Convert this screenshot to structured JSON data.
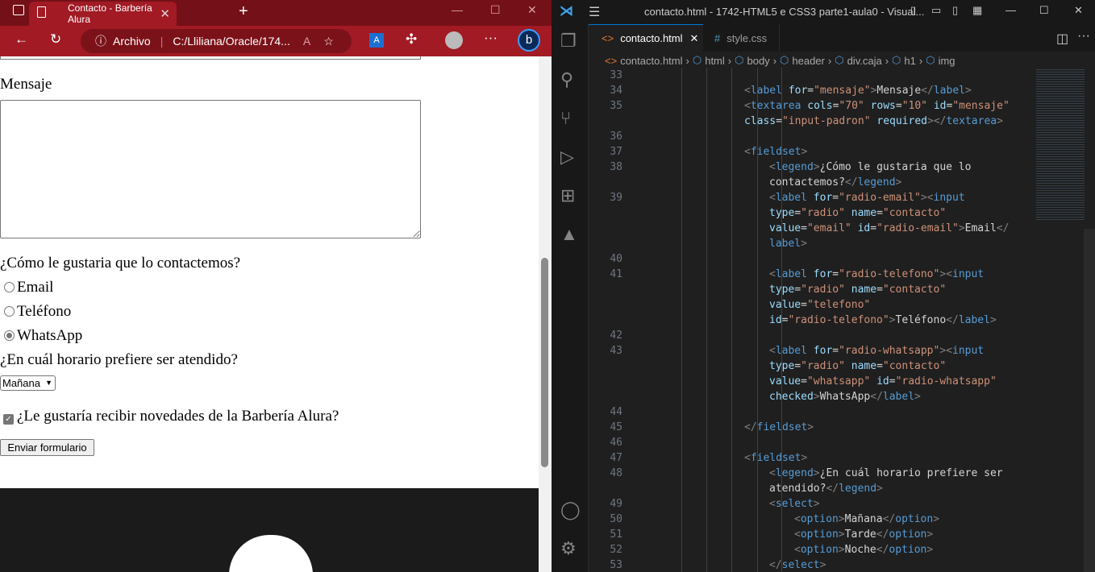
{
  "browser": {
    "tab_title": "Contacto - Barbería Alura",
    "address_scheme": "Archivo",
    "address_url": "C:/Lliliana/Oracle/174...",
    "form": {
      "message_label": "Mensaje",
      "contact_legend": "¿Cómo le gustaria que lo contactemos?",
      "radios": [
        {
          "label": "Email",
          "checked": false
        },
        {
          "label": "Teléfono",
          "checked": false
        },
        {
          "label": "WhatsApp",
          "checked": true
        }
      ],
      "schedule_legend": "¿En cuál horario prefiere ser atendido?",
      "schedule_value": "Mañana",
      "newsletter_label": "¿Le gustaría recibir novedades de la Barbería Alura?",
      "newsletter_checked": true,
      "submit_label": "Enviar formulario"
    }
  },
  "vscode": {
    "window_title": "contacto.html - 1742-HTML5 e CSS3 parte1-aula0 - Visual...",
    "tabs": [
      {
        "label": "contacto.html",
        "active": true
      },
      {
        "label": "style.css",
        "active": false
      }
    ],
    "breadcrumbs": [
      "contacto.html",
      "html",
      "body",
      "header",
      "div.caja",
      "h1",
      "img"
    ],
    "lines": [
      {
        "n": "33",
        "i": 0,
        "tk": []
      },
      {
        "n": "34",
        "i": 0,
        "tk": [
          [
            "p",
            "<"
          ],
          [
            "tg",
            "label"
          ],
          [
            "x",
            " "
          ],
          [
            "a",
            "for"
          ],
          [
            "x",
            "="
          ],
          [
            "s",
            "\"mensaje\""
          ],
          [
            "p",
            ">"
          ],
          [
            "x",
            "Mensaje"
          ],
          [
            "p",
            "</"
          ],
          [
            "tg",
            "label"
          ],
          [
            "p",
            ">"
          ]
        ]
      },
      {
        "n": "35",
        "i": 0,
        "tk": [
          [
            "p",
            "<"
          ],
          [
            "tg",
            "textarea"
          ],
          [
            "x",
            " "
          ],
          [
            "a",
            "cols"
          ],
          [
            "x",
            "="
          ],
          [
            "s",
            "\"70\""
          ],
          [
            "x",
            " "
          ],
          [
            "a",
            "rows"
          ],
          [
            "x",
            "="
          ],
          [
            "s",
            "\"10\""
          ],
          [
            "x",
            " "
          ],
          [
            "a",
            "id"
          ],
          [
            "x",
            "="
          ],
          [
            "s",
            "\"mensaje\""
          ]
        ]
      },
      {
        "n": "",
        "i": 0,
        "tk": [
          [
            "a",
            "class"
          ],
          [
            "x",
            "="
          ],
          [
            "s",
            "\"input-padron\""
          ],
          [
            "x",
            " "
          ],
          [
            "a",
            "required"
          ],
          [
            "p",
            "></"
          ],
          [
            "tg",
            "textarea"
          ],
          [
            "p",
            ">"
          ]
        ]
      },
      {
        "n": "36",
        "i": 0,
        "tk": []
      },
      {
        "n": "37",
        "i": 0,
        "tk": [
          [
            "p",
            "<"
          ],
          [
            "tg",
            "fieldset"
          ],
          [
            "p",
            ">"
          ]
        ]
      },
      {
        "n": "38",
        "i": 1,
        "tk": [
          [
            "p",
            "<"
          ],
          [
            "tg",
            "legend"
          ],
          [
            "p",
            ">"
          ],
          [
            "x",
            "¿Cómo le gustaria que lo"
          ]
        ]
      },
      {
        "n": "",
        "i": 1,
        "tk": [
          [
            "x",
            "contactemos?"
          ],
          [
            "p",
            "</"
          ],
          [
            "tg",
            "legend"
          ],
          [
            "p",
            ">"
          ]
        ]
      },
      {
        "n": "39",
        "i": 1,
        "tk": [
          [
            "p",
            "<"
          ],
          [
            "tg",
            "label"
          ],
          [
            "x",
            " "
          ],
          [
            "a",
            "for"
          ],
          [
            "x",
            "="
          ],
          [
            "s",
            "\"radio-email\""
          ],
          [
            "p",
            "><"
          ],
          [
            "tg",
            "input"
          ]
        ]
      },
      {
        "n": "",
        "i": 1,
        "tk": [
          [
            "a",
            "type"
          ],
          [
            "x",
            "="
          ],
          [
            "s",
            "\"radio\""
          ],
          [
            "x",
            " "
          ],
          [
            "a",
            "name"
          ],
          [
            "x",
            "="
          ],
          [
            "s",
            "\"contacto\""
          ]
        ]
      },
      {
        "n": "",
        "i": 1,
        "tk": [
          [
            "a",
            "value"
          ],
          [
            "x",
            "="
          ],
          [
            "s",
            "\"email\""
          ],
          [
            "x",
            " "
          ],
          [
            "a",
            "id"
          ],
          [
            "x",
            "="
          ],
          [
            "s",
            "\"radio-email\""
          ],
          [
            "p",
            ">"
          ],
          [
            "x",
            "Email"
          ],
          [
            "p",
            "</"
          ]
        ]
      },
      {
        "n": "",
        "i": 1,
        "tk": [
          [
            "tg",
            "label"
          ],
          [
            "p",
            ">"
          ]
        ]
      },
      {
        "n": "40",
        "i": 1,
        "tk": []
      },
      {
        "n": "41",
        "i": 1,
        "tk": [
          [
            "p",
            "<"
          ],
          [
            "tg",
            "label"
          ],
          [
            "x",
            " "
          ],
          [
            "a",
            "for"
          ],
          [
            "x",
            "="
          ],
          [
            "s",
            "\"radio-telefono\""
          ],
          [
            "p",
            "><"
          ],
          [
            "tg",
            "input"
          ]
        ]
      },
      {
        "n": "",
        "i": 1,
        "tk": [
          [
            "a",
            "type"
          ],
          [
            "x",
            "="
          ],
          [
            "s",
            "\"radio\""
          ],
          [
            "x",
            " "
          ],
          [
            "a",
            "name"
          ],
          [
            "x",
            "="
          ],
          [
            "s",
            "\"contacto\""
          ]
        ]
      },
      {
        "n": "",
        "i": 1,
        "tk": [
          [
            "a",
            "value"
          ],
          [
            "x",
            "="
          ],
          [
            "s",
            "\"telefono\""
          ]
        ]
      },
      {
        "n": "",
        "i": 1,
        "tk": [
          [
            "a",
            "id"
          ],
          [
            "x",
            "="
          ],
          [
            "s",
            "\"radio-telefono\""
          ],
          [
            "p",
            ">"
          ],
          [
            "x",
            "Teléfono"
          ],
          [
            "p",
            "</"
          ],
          [
            "tg",
            "label"
          ],
          [
            "p",
            ">"
          ]
        ]
      },
      {
        "n": "42",
        "i": 1,
        "tk": []
      },
      {
        "n": "43",
        "i": 1,
        "tk": [
          [
            "p",
            "<"
          ],
          [
            "tg",
            "label"
          ],
          [
            "x",
            " "
          ],
          [
            "a",
            "for"
          ],
          [
            "x",
            "="
          ],
          [
            "s",
            "\"radio-whatsapp\""
          ],
          [
            "p",
            "><"
          ],
          [
            "tg",
            "input"
          ]
        ]
      },
      {
        "n": "",
        "i": 1,
        "tk": [
          [
            "a",
            "type"
          ],
          [
            "x",
            "="
          ],
          [
            "s",
            "\"radio\""
          ],
          [
            "x",
            " "
          ],
          [
            "a",
            "name"
          ],
          [
            "x",
            "="
          ],
          [
            "s",
            "\"contacto\""
          ]
        ]
      },
      {
        "n": "",
        "i": 1,
        "tk": [
          [
            "a",
            "value"
          ],
          [
            "x",
            "="
          ],
          [
            "s",
            "\"whatsapp\""
          ],
          [
            "x",
            " "
          ],
          [
            "a",
            "id"
          ],
          [
            "x",
            "="
          ],
          [
            "s",
            "\"radio-whatsapp\""
          ]
        ]
      },
      {
        "n": "",
        "i": 1,
        "tk": [
          [
            "a",
            "checked"
          ],
          [
            "p",
            ">"
          ],
          [
            "x",
            "WhatsApp"
          ],
          [
            "p",
            "</"
          ],
          [
            "tg",
            "label"
          ],
          [
            "p",
            ">"
          ]
        ]
      },
      {
        "n": "44",
        "i": 1,
        "tk": []
      },
      {
        "n": "45",
        "i": 0,
        "tk": [
          [
            "p",
            "</"
          ],
          [
            "tg",
            "fieldset"
          ],
          [
            "p",
            ">"
          ]
        ]
      },
      {
        "n": "46",
        "i": 0,
        "tk": []
      },
      {
        "n": "47",
        "i": 0,
        "tk": [
          [
            "p",
            "<"
          ],
          [
            "tg",
            "fieldset"
          ],
          [
            "p",
            ">"
          ]
        ]
      },
      {
        "n": "48",
        "i": 1,
        "tk": [
          [
            "p",
            "<"
          ],
          [
            "tg",
            "legend"
          ],
          [
            "p",
            ">"
          ],
          [
            "x",
            "¿En cuál horario prefiere ser"
          ]
        ]
      },
      {
        "n": "",
        "i": 1,
        "tk": [
          [
            "x",
            "atendido?"
          ],
          [
            "p",
            "</"
          ],
          [
            "tg",
            "legend"
          ],
          [
            "p",
            ">"
          ]
        ]
      },
      {
        "n": "49",
        "i": 1,
        "tk": [
          [
            "p",
            "<"
          ],
          [
            "tg",
            "select"
          ],
          [
            "p",
            ">"
          ]
        ]
      },
      {
        "n": "50",
        "i": 2,
        "tk": [
          [
            "p",
            "<"
          ],
          [
            "tg",
            "option"
          ],
          [
            "p",
            ">"
          ],
          [
            "x",
            "Mañana"
          ],
          [
            "p",
            "</"
          ],
          [
            "tg",
            "option"
          ],
          [
            "p",
            ">"
          ]
        ]
      },
      {
        "n": "51",
        "i": 2,
        "tk": [
          [
            "p",
            "<"
          ],
          [
            "tg",
            "option"
          ],
          [
            "p",
            ">"
          ],
          [
            "x",
            "Tarde"
          ],
          [
            "p",
            "</"
          ],
          [
            "tg",
            "option"
          ],
          [
            "p",
            ">"
          ]
        ]
      },
      {
        "n": "52",
        "i": 2,
        "tk": [
          [
            "p",
            "<"
          ],
          [
            "tg",
            "option"
          ],
          [
            "p",
            ">"
          ],
          [
            "x",
            "Noche"
          ],
          [
            "p",
            "</"
          ],
          [
            "tg",
            "option"
          ],
          [
            "p",
            ">"
          ]
        ]
      },
      {
        "n": "53",
        "i": 1,
        "tk": [
          [
            "p",
            "</"
          ],
          [
            "tg",
            "select"
          ],
          [
            "p",
            ">"
          ]
        ]
      }
    ]
  },
  "colors": {
    "browser_frame": "#a11a24",
    "tag": "#569cd6",
    "attr": "#9cdcfe",
    "string": "#ce9178",
    "editor_bg": "#1f1f1f"
  }
}
